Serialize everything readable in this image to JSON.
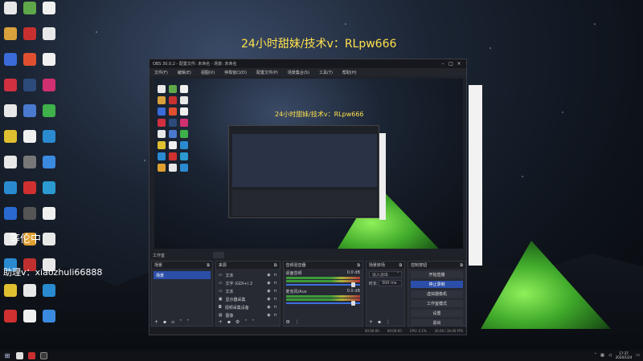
{
  "overlay": {
    "title": "24小时甜妹/技术v：RLpw666",
    "left_text1": "等伦中",
    "left_text2": "助理v：xiaozhuli66888"
  },
  "desktop_icons": [
    {
      "color": "#e8e8e8"
    },
    {
      "color": "#5fa84a"
    },
    {
      "color": "#f0f0f0"
    },
    {
      "color": "#d9a13b"
    },
    {
      "color": "#c83030"
    },
    {
      "color": "#e8e8e8"
    },
    {
      "color": "#3a6bd9"
    },
    {
      "color": "#e05030"
    },
    {
      "color": "#f0f0f0"
    },
    {
      "color": "#d03040"
    },
    {
      "color": "#2c4a7a"
    },
    {
      "color": "#d03070"
    },
    {
      "color": "#e8e8e8"
    },
    {
      "color": "#4a7ad0"
    },
    {
      "color": "#3fb04a"
    },
    {
      "color": "#e0c030"
    },
    {
      "color": "#f0f0f0"
    },
    {
      "color": "#2a8ad0"
    },
    {
      "color": "#e8e8e8"
    },
    {
      "color": "#777"
    },
    {
      "color": "#3a8ae0"
    },
    {
      "color": "#2a8ad0"
    },
    {
      "color": "#d03030"
    },
    {
      "color": "#2a9ad0"
    },
    {
      "color": "#2a6ad0"
    },
    {
      "color": "#555"
    },
    {
      "color": "#f0f0f0"
    },
    {
      "color": "#e8e8e8"
    },
    {
      "color": "#e0a030"
    },
    {
      "color": "#e8e8e8"
    },
    {
      "color": "#2a8ad0"
    },
    {
      "color": "#c03030"
    },
    {
      "color": "#e8e8e8"
    },
    {
      "color": "#e0c030"
    },
    {
      "color": "#e8e8e8"
    },
    {
      "color": "#2a8ad0"
    },
    {
      "color": "#d03030"
    },
    {
      "color": "#f0f0f0"
    },
    {
      "color": "#3a8ae0"
    }
  ],
  "obs": {
    "title": "OBS 30.0.2 - 配置文件: 未命名 - 场景: 未命名",
    "menu": [
      "文件(F)",
      "编辑(E)",
      "视图(V)",
      "停靠窗口(D)",
      "配置文件(P)",
      "场景集合(S)",
      "工具(T)",
      "帮助(H)"
    ],
    "preview_title": "24小时甜妹/技术v：RLpw666",
    "toolbar_label": "工作室",
    "docks": {
      "scenes": {
        "header": "场景",
        "items": [
          "场景"
        ]
      },
      "sources": {
        "header": "来源",
        "items": [
          "文本",
          "文字 (GDI+) 2",
          "文本",
          "显示器采集",
          "视频采集设备",
          "图像"
        ]
      },
      "mixer": {
        "header": "音频混音器",
        "channels": [
          {
            "name": "桌面音频",
            "db": "0.0 dB"
          },
          {
            "name": "麦克风/Aux",
            "db": "0.0 dB"
          }
        ]
      },
      "transitions": {
        "header": "场景转场",
        "type": "淡入淡出",
        "duration_label": "时长",
        "duration": "300 ms"
      },
      "controls": {
        "header": "控制按钮",
        "buttons": [
          "开始直播",
          "停止录制",
          "虚拟摄像机",
          "工作室模式",
          "设置",
          "退出"
        ]
      }
    },
    "status": [
      "00:00:00",
      "00:00:00",
      "CPU: 2.1%",
      "30.00 / 30.00 FPS"
    ]
  },
  "taskbar": {
    "time": "17:37",
    "date": "2024/1/24"
  }
}
